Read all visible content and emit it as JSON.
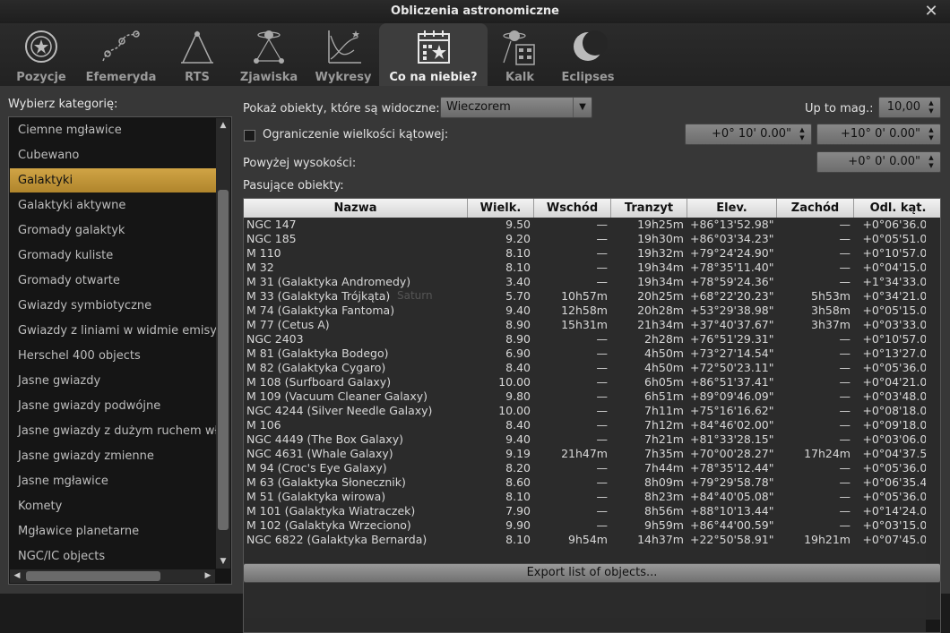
{
  "window": {
    "title": "Obliczenia astronomiczne",
    "close_glyph": "✕"
  },
  "tabs": [
    {
      "label": "Pozycje",
      "icon": "positions-target-icon"
    },
    {
      "label": "Efemeryda",
      "icon": "ephemeris-path-icon"
    },
    {
      "label": "RTS",
      "icon": "rise-transit-set-icon"
    },
    {
      "label": "Zjawiska",
      "icon": "phenomena-icon"
    },
    {
      "label": "Wykresy",
      "icon": "graphs-icon"
    },
    {
      "label": "Co na niebie?",
      "icon": "calendar-star-icon",
      "active": true
    },
    {
      "label": "Kalk",
      "icon": "calculator-planet-icon"
    },
    {
      "label": "Eclipses",
      "icon": "eclipse-moon-icon"
    }
  ],
  "category": {
    "label": "Wybierz kategorię:",
    "items": [
      "Ciemne mgławice",
      "Cubewano",
      "Galaktyki",
      "Galaktyki aktywne",
      "Gromady galaktyk",
      "Gromady kuliste",
      "Gromady otwarte",
      "Gwiazdy symbiotyczne",
      "Gwiazdy z liniami w widmie emisyjnym",
      "Herschel 400 objects",
      "Jasne gwiazdy",
      "Jasne gwiazdy podwójne",
      "Jasne gwiazdy z dużym ruchem własnym",
      "Jasne gwiazdy zmienne",
      "Jasne mgławice",
      "Komety",
      "Mgławice planetarne",
      "NGC/IC objects"
    ],
    "selected_index": 2
  },
  "filters": {
    "show_visible_label": "Pokaż obiekty, które są widoczne:",
    "show_visible_value": "Wieczorem",
    "up_to_mag_label": "Up to mag.:",
    "up_to_mag_value": "10,00",
    "angular_limit_label": "Ograniczenie wielkości kątowej:",
    "angular_limit_checked": false,
    "angular_min": "+0° 10' 0.00\"",
    "angular_max": "+10° 0' 0.00\"",
    "above_altitude_label": "Powyżej wysokości:",
    "above_altitude_value": "+0° 0' 0.00\"",
    "matching_label": "Pasujące obiekty:"
  },
  "table": {
    "columns": [
      "Nazwa",
      "Wielk.",
      "Wschód",
      "Tranzyt",
      "Elev.",
      "Zachód",
      "Odl. kąt."
    ],
    "rows": [
      [
        "NGC 147",
        "9.50",
        "—",
        "19h25m",
        "+86°13'52.98\"",
        "—",
        "+0°06'36.00\""
      ],
      [
        "NGC 185",
        "9.20",
        "—",
        "19h30m",
        "+86°03'34.23\"",
        "—",
        "+0°05'51.00\""
      ],
      [
        "M 110",
        "8.10",
        "—",
        "19h32m",
        "+79°24'24.90\"",
        "—",
        "+0°10'57.00\""
      ],
      [
        "M 32",
        "8.10",
        "—",
        "19h34m",
        "+78°35'11.40\"",
        "—",
        "+0°04'15.00\""
      ],
      [
        "M 31 (Galaktyka Andromedy)",
        "3.40",
        "—",
        "19h34m",
        "+78°59'24.36\"",
        "—",
        "+1°34'33.00\""
      ],
      [
        "M 33 (Galaktyka Trójkąta)",
        "5.70",
        "10h57m",
        "20h25m",
        "+68°22'20.23\"",
        "5h53m",
        "+0°34'21.00\""
      ],
      [
        "M 74 (Galaktyka Fantoma)",
        "9.40",
        "12h58m",
        "20h28m",
        "+53°29'38.98\"",
        "3h58m",
        "+0°05'15.00\""
      ],
      [
        "M 77 (Cetus A)",
        "8.90",
        "15h31m",
        "21h34m",
        "+37°40'37.67\"",
        "3h37m",
        "+0°03'33.00\""
      ],
      [
        "NGC 2403",
        "8.90",
        "—",
        "2h28m",
        "+76°51'29.31\"",
        "—",
        "+0°10'57.00\""
      ],
      [
        "M 81 (Galaktyka Bodego)",
        "6.90",
        "—",
        "4h50m",
        "+73°27'14.54\"",
        "—",
        "+0°13'27.00\""
      ],
      [
        "M 82 (Galaktyka Cygaro)",
        "8.40",
        "—",
        "4h50m",
        "+72°50'23.11\"",
        "—",
        "+0°05'36.00\""
      ],
      [
        "M 108 (Surfboard Galaxy)",
        "10.00",
        "—",
        "6h05m",
        "+86°51'37.41\"",
        "—",
        "+0°04'21.00\""
      ],
      [
        "M 109 (Vacuum Cleaner Galaxy)",
        "9.80",
        "—",
        "6h51m",
        "+89°09'46.09\"",
        "—",
        "+0°03'48.00\""
      ],
      [
        "NGC 4244 (Silver Needle Galaxy)",
        "10.00",
        "—",
        "7h11m",
        "+75°16'16.62\"",
        "—",
        "+0°08'18.00\""
      ],
      [
        "M 106",
        "8.40",
        "—",
        "7h12m",
        "+84°46'02.00\"",
        "—",
        "+0°09'18.00\""
      ],
      [
        "NGC 4449 (The Box Galaxy)",
        "9.40",
        "—",
        "7h21m",
        "+81°33'28.15\"",
        "—",
        "+0°03'06.00\""
      ],
      [
        "NGC 4631 (Whale Galaxy)",
        "9.19",
        "21h47m",
        "7h35m",
        "+70°00'28.27\"",
        "17h24m",
        "+0°04'37.59\""
      ],
      [
        "M 94 (Croc's Eye Galaxy)",
        "8.20",
        "—",
        "7h44m",
        "+78°35'12.44\"",
        "—",
        "+0°05'36.00\""
      ],
      [
        "M 63 (Galaktyka Słonecznik)",
        "8.60",
        "—",
        "8h09m",
        "+79°29'58.78\"",
        "—",
        "+0°06'35.40\""
      ],
      [
        "M 51 (Galaktyka wirowa)",
        "8.10",
        "—",
        "8h23m",
        "+84°40'05.08\"",
        "—",
        "+0°05'36.00\""
      ],
      [
        "M 101 (Galaktyka Wiatraczek)",
        "7.90",
        "—",
        "8h56m",
        "+88°10'13.44\"",
        "—",
        "+0°14'24.00\""
      ],
      [
        "M 102 (Galaktyka Wrzeciono)",
        "9.90",
        "—",
        "9h59m",
        "+86°44'00.59\"",
        "—",
        "+0°03'15.00\""
      ],
      [
        "NGC 6822 (Galaktyka Bernarda)",
        "8.10",
        "9h54m",
        "14h37m",
        "+22°50'58.91\"",
        "19h21m",
        "+0°07'45.00\""
      ]
    ]
  },
  "ghost_text": "Saturn",
  "export_label": "Export list of objects..."
}
